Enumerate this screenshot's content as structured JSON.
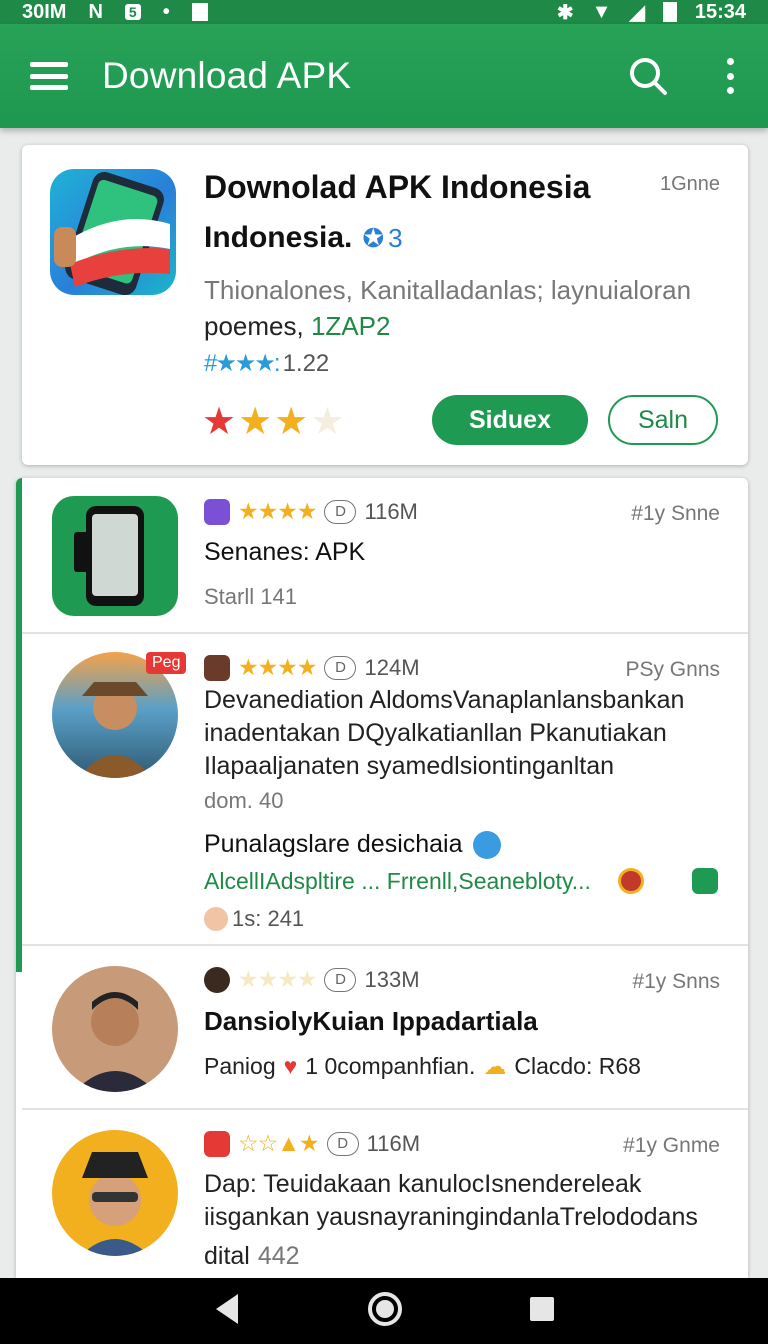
{
  "status": {
    "left": "30IM",
    "n": "N",
    "badge": "5",
    "dot": "•",
    "time": "15:34"
  },
  "appbar": {
    "title": "Download APK",
    "menu_icon": "hamburger-icon",
    "search_icon": "search-icon",
    "more_icon": "more-vert-icon"
  },
  "featured": {
    "title": "Downolad APK Indonesia",
    "subtitle": "Indonesia.",
    "rank": "3",
    "size": "1Gnne",
    "description": "Thionalones, Kanitalladanlas; laynuialoran",
    "category_prefix": "poemes, ",
    "category_code": "1ZAP2",
    "rating_stars": "#★★★:",
    "rating_value": "1.22",
    "big_stars": "★★★★",
    "primary_button": "Siduex",
    "secondary_button": "Saln"
  },
  "items": [
    {
      "size": "116M",
      "tag": "#1y Snne",
      "title": "Senanes: APK",
      "sub": "Starll 141",
      "badge": "D"
    },
    {
      "size": "124M",
      "tag": "PSy Gnns",
      "badge": "D",
      "corner_label": "Peg",
      "line1": "Devanediation AldomsVanaplanlansbankan",
      "line2": "inadentakan DQyalkatianllan Pkanutiakan",
      "line3": "Ilapaaljanaten syamedlsiontinganltan",
      "sub": "dom. 40",
      "headline": "Punalagslare desichaia",
      "link": "AlcellIAdspltire ... Frrenll,Seanebloty...",
      "count": "1s: 241"
    },
    {
      "size": "133M",
      "tag": "#1y Snns",
      "badge": "D",
      "title": "DansiolyKuian Ippadartiala",
      "sub_prefix": "Paniog",
      "sub_mid": "1 0companhfian.",
      "sub_suffix": "Clacdo: R68"
    },
    {
      "size": "116M",
      "tag": "#1y Gnme",
      "badge": "D",
      "line1": "Dap: Teuidakaan kanulocIsnendereleak",
      "line2": "iisgankan yausnayraningindanlaTrelododans",
      "sub_prefix": "dital",
      "sub_value": "442"
    }
  ],
  "colors": {
    "primary": "#1f9a52",
    "accent_blue": "#2a7fd8",
    "star_gold": "#f2b01e",
    "star_red": "#e53935"
  }
}
